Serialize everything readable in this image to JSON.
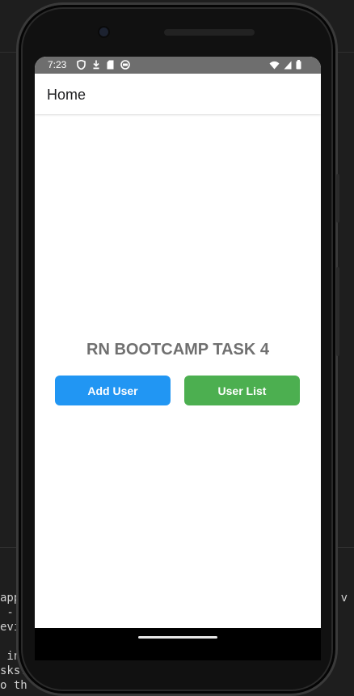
{
  "device": {
    "status_bar": {
      "time": "7:23",
      "left_icons": [
        "shield-icon",
        "download-icon",
        "sd-card-icon",
        "android-icon"
      ],
      "right_icons": [
        "wifi-icon",
        "cellular-signal-icon",
        "battery-icon"
      ]
    },
    "app_bar": {
      "title": "Home"
    }
  },
  "main": {
    "heading": "RN BOOTCAMP TASK 4",
    "buttons": {
      "add_user": {
        "label": "Add User",
        "color": "#2196F3"
      },
      "user_list": {
        "label": "User List",
        "color": "#4CAF50"
      }
    }
  },
  "background_terminal": {
    "left_fragments": [
      "app",
      " -",
      "evi",
      "",
      " in",
      "sks:",
      "o th"
    ],
    "right_fragment": "v"
  },
  "colors": {
    "status_bar": "#6E6E6E",
    "heading_text": "#707070",
    "ide_background": "#1E1E1E"
  }
}
